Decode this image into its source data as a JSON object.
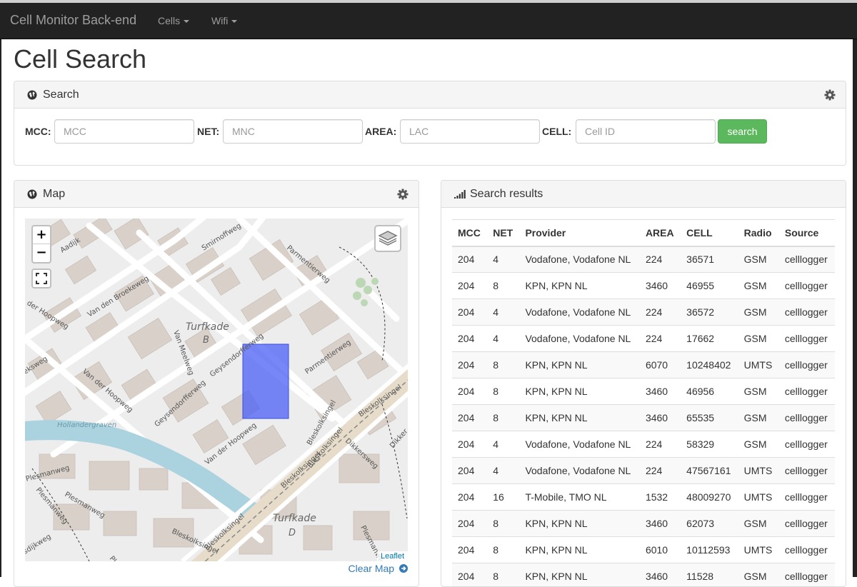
{
  "navbar": {
    "brand": "Cell Monitor Back-end",
    "items": [
      {
        "label": "Cells"
      },
      {
        "label": "Wifi"
      }
    ]
  },
  "page": {
    "title": "Cell Search"
  },
  "search_panel": {
    "title": "Search",
    "fields": [
      {
        "label": "MCC:",
        "placeholder": "MCC",
        "value": ""
      },
      {
        "label": "NET:",
        "placeholder": "MNC",
        "value": ""
      },
      {
        "label": "AREA:",
        "placeholder": "LAC",
        "value": ""
      },
      {
        "label": "CELL:",
        "placeholder": "Cell ID",
        "value": ""
      }
    ],
    "button_label": "search"
  },
  "map_panel": {
    "title": "Map",
    "zoom_in": "+",
    "zoom_out": "−",
    "attribution": "Leaflet",
    "clear_label": "Clear Map",
    "labels": {
      "aadijk": "Aadijk",
      "smirnoffweg": "Smirnoffweg",
      "parmentierweg_top": "Parmentierweg",
      "van_den_broekeweg": "Van den Broekeweg",
      "der_hoopweg": "der Hoopweg",
      "turfkade_b": "Turfkade",
      "turfkade_b_letter": "B",
      "van_meelweg": "Van Meelweg",
      "geysendorfferweg_top": "Geysendorfferweg",
      "parmentierweg_mid": "Parmentierweg",
      "eksweg": "eksweg",
      "van_der_hoopweg_left": "Van der Hoopweg",
      "geysendorfferweg_bottom": "Geysendorfferweg",
      "hollandergraven": "Hollandergraven",
      "bleskolksingel_1": "Bleskolksingel",
      "bleskolksingel_2": "Bleskolksingel",
      "bleskolksingel_3": "Bleskolksingel",
      "bleskolksingel_4": "Bleskolksingel",
      "bleskolksingel_5": "Bleskolksingel",
      "bleskolksingel_6": "Bleskolksingel",
      "van_der_hoopweg_bottom": "Van der Hoopweg",
      "dikkersweg": "Dikkersweg",
      "dikker": "Dikker",
      "plesmanweg_1": "Plesmanweg",
      "plesmanweg_2": "Plesmanweg",
      "plesmanweg_3": "Plesmanweg",
      "plesmanweg_4": "Plesmanweg",
      "sdijkweg": "sdijkweg",
      "turfkade_d": "Turfkade",
      "turfkade_d_letter": "D",
      "ple": "Ple"
    },
    "colors": {
      "selection": "#4a5ff5",
      "water": "#aad3df"
    }
  },
  "results_panel": {
    "title": "Search results",
    "columns": [
      "MCC",
      "NET",
      "Provider",
      "AREA",
      "CELL",
      "Radio",
      "Source"
    ],
    "rows": [
      [
        "204",
        "4",
        "Vodafone, Vodafone NL",
        "224",
        "36571",
        "GSM",
        "celllogger"
      ],
      [
        "204",
        "8",
        "KPN, KPN NL",
        "3460",
        "46955",
        "GSM",
        "celllogger"
      ],
      [
        "204",
        "4",
        "Vodafone, Vodafone NL",
        "224",
        "36572",
        "GSM",
        "celllogger"
      ],
      [
        "204",
        "4",
        "Vodafone, Vodafone NL",
        "224",
        "17662",
        "GSM",
        "celllogger"
      ],
      [
        "204",
        "8",
        "KPN, KPN NL",
        "6070",
        "10248402",
        "UMTS",
        "celllogger"
      ],
      [
        "204",
        "8",
        "KPN, KPN NL",
        "3460",
        "46956",
        "GSM",
        "celllogger"
      ],
      [
        "204",
        "8",
        "KPN, KPN NL",
        "3460",
        "65535",
        "GSM",
        "celllogger"
      ],
      [
        "204",
        "4",
        "Vodafone, Vodafone NL",
        "224",
        "58329",
        "GSM",
        "celllogger"
      ],
      [
        "204",
        "4",
        "Vodafone, Vodafone NL",
        "224",
        "47567161",
        "UMTS",
        "celllogger"
      ],
      [
        "204",
        "16",
        "T-Mobile, TMO NL",
        "1532",
        "48009270",
        "UMTS",
        "celllogger"
      ],
      [
        "204",
        "8",
        "KPN, KPN NL",
        "3460",
        "62073",
        "GSM",
        "celllogger"
      ],
      [
        "204",
        "8",
        "KPN, KPN NL",
        "6010",
        "10112593",
        "UMTS",
        "celllogger"
      ],
      [
        "204",
        "8",
        "KPN, KPN NL",
        "3460",
        "11528",
        "GSM",
        "celllogger"
      ]
    ]
  }
}
